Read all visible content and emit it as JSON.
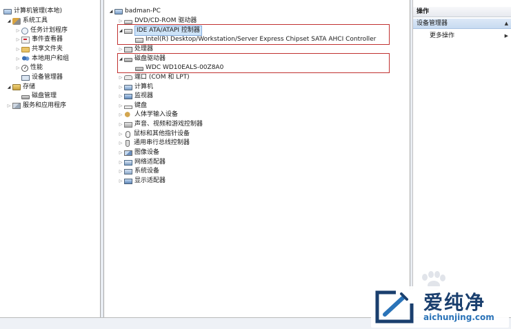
{
  "left_tree": {
    "root": "计算机管理(本地)",
    "system_tools": "系统工具",
    "task_scheduler": "任务计划程序",
    "event_viewer": "事件查看器",
    "shared_folders": "共享文件夹",
    "local_users": "本地用户和组",
    "performance": "性能",
    "device_manager": "设备管理器",
    "storage": "存储",
    "disk_management": "磁盘管理",
    "services": "服务和应用程序"
  },
  "device_tree": {
    "computer_name": "badman-PC",
    "dvd": "DVD/CD-ROM 驱动器",
    "ide": "IDE ATA/ATAPI 控制器",
    "ide_child": "Intel(R) Desktop/Workstation/Server Express Chipset SATA AHCI Controller",
    "processor": "处理器",
    "disk_drives": "磁盘驱动器",
    "disk_child": "WDC WD10EALS-00Z8A0",
    "ports": "端口 (COM 和 LPT)",
    "computer": "计算机",
    "monitors": "监视器",
    "keyboard": "键盘",
    "hid": "人体学输入设备",
    "sound": "声音、视频和游戏控制器",
    "mouse": "鼠标和其他指针设备",
    "usb": "通用串行总线控制器",
    "imaging": "图像设备",
    "network": "网络适配器",
    "system": "系统设备",
    "display": "显示适配器"
  },
  "actions": {
    "header": "操作",
    "section": "设备管理器",
    "more": "更多操作"
  },
  "watermark": {
    "title": "爱纯净",
    "url": "aichunjing.com"
  },
  "colors": {
    "highlight_box": "#c0302f",
    "selection": "#cde3f8",
    "watermark_dark": "#1a3f6e",
    "watermark_blue": "#2a73b8"
  }
}
